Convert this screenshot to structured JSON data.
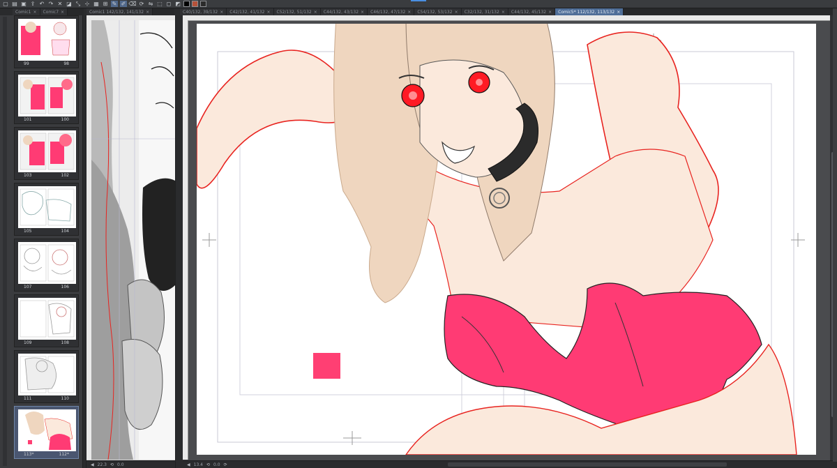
{
  "toolbar": {
    "icons": [
      "new-icon",
      "open-icon",
      "save-icon",
      "export-icon",
      "undo-icon",
      "redo-icon",
      "clear-icon",
      "fill-icon",
      "transform-icon",
      "snap-icon",
      "grid-icon",
      "ruler-icon",
      "pen-icon",
      "brush-icon",
      "eraser-icon",
      "rotate-icon",
      "flip-icon",
      "select-all-icon",
      "deselect-icon",
      "invert-icon"
    ],
    "swatches": [
      "#000000",
      "#b5523a",
      "#2b2b2b"
    ],
    "accent_color": "#4a8fe2"
  },
  "left_tabs": [
    {
      "label": "Comic1",
      "active": false
    },
    {
      "label": "Comic7",
      "active": false
    }
  ],
  "middle_tabs": [
    {
      "label": "Comic1 142/132, 141/132",
      "active": false
    }
  ],
  "main_tabs": [
    {
      "label": "C40/132, 39/132",
      "active": false
    },
    {
      "label": "C42/132, 41/132",
      "active": false
    },
    {
      "label": "C52/132, 51/132",
      "active": false
    },
    {
      "label": "C44/132, 43/132",
      "active": false
    },
    {
      "label": "C46/132, 47/132",
      "active": false
    },
    {
      "label": "C54/132, 53/132",
      "active": false
    },
    {
      "label": "C32/132, 31/132",
      "active": false
    },
    {
      "label": "C44/132, 45/132",
      "active": false
    },
    {
      "label": "Comic5* 112/132, 113/132",
      "active": true
    }
  ],
  "pages": [
    {
      "left": "99",
      "right": "98"
    },
    {
      "left": "101",
      "right": "100"
    },
    {
      "left": "103",
      "right": "102"
    },
    {
      "left": "105",
      "right": "104"
    },
    {
      "left": "107",
      "right": "106"
    },
    {
      "left": "109",
      "right": "108"
    },
    {
      "left": "111",
      "right": "110"
    },
    {
      "left": "113*",
      "right": "112*",
      "current": true
    }
  ],
  "status_middle": {
    "zoom": "22.3",
    "angle": "0.0"
  },
  "status_main": {
    "zoom": "13.4",
    "angle": "0.0"
  },
  "colors": {
    "skin": "#fbe9dc",
    "hair": "#efd6bf",
    "suit": "#ff3b74",
    "line_red": "#e8231f",
    "eye": "#ff1a24",
    "collar": "#2b2b2b",
    "swatch": "#ff3f73"
  }
}
